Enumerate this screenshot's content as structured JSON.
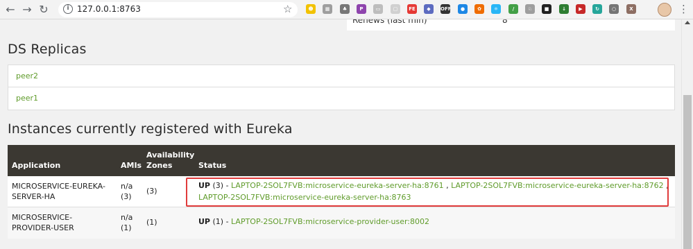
{
  "browser": {
    "url": "127.0.0.1:8763",
    "extensions": [
      {
        "icon": "smiley-ext-icon",
        "color": "#f2c200",
        "glyph": "☻"
      },
      {
        "icon": "grid-ext-icon",
        "color": "#9e9e9e",
        "glyph": "▦"
      },
      {
        "icon": "tree-ext-icon",
        "color": "#777777",
        "glyph": "♣"
      },
      {
        "icon": "purple-ext-icon",
        "color": "#8e44ad",
        "glyph": "P"
      },
      {
        "icon": "folder-ext-icon",
        "color": "#bdbdbd",
        "glyph": "▭"
      },
      {
        "icon": "doc-ext-icon",
        "color": "#d0d0d0",
        "glyph": "▢"
      },
      {
        "icon": "fe-ext-icon",
        "color": "#e53935",
        "glyph": "FE"
      },
      {
        "icon": "shield-ext-icon",
        "color": "#5c6bc0",
        "glyph": "◆"
      },
      {
        "icon": "off-ext-icon",
        "color": "#333333",
        "glyph": "OFF"
      },
      {
        "icon": "blue-circle-ext-icon",
        "color": "#1e88e5",
        "glyph": "●"
      },
      {
        "icon": "orange-ext-icon",
        "color": "#ef6c00",
        "glyph": "✿"
      },
      {
        "icon": "react-ext-icon",
        "color": "#29b6f6",
        "glyph": "⚛"
      },
      {
        "icon": "slash-ext-icon",
        "color": "#43a047",
        "glyph": "/"
      },
      {
        "icon": "cat-ext-icon",
        "color": "#9e9e9e",
        "glyph": "♘"
      },
      {
        "icon": "dark-ext-icon",
        "color": "#212121",
        "glyph": "■"
      },
      {
        "icon": "download-ext-icon",
        "color": "#2e7d32",
        "glyph": "↓"
      },
      {
        "icon": "play-ext-icon",
        "color": "#c62828",
        "glyph": "▶"
      },
      {
        "icon": "refresh-ext-icon",
        "color": "#26a69a",
        "glyph": "↻"
      },
      {
        "icon": "record-ext-icon",
        "color": "#757575",
        "glyph": "○"
      },
      {
        "icon": "x-ext-icon",
        "color": "#8d6e63",
        "glyph": "X"
      }
    ]
  },
  "stats": {
    "label": "Renews (last min)",
    "value": "8"
  },
  "replicas": {
    "title": "DS Replicas",
    "items": [
      "peer2",
      "peer1"
    ]
  },
  "instances": {
    "title": "Instances currently registered with Eureka",
    "headers": {
      "application": "Application",
      "amis": "AMIs",
      "zones_line1": "Availability",
      "zones_line2": "Zones",
      "status": "Status"
    },
    "rows": [
      {
        "app_line1": "MICROSERVICE-EUREKA-",
        "app_line2": "SERVER-HA",
        "amis_line1": "n/a",
        "amis_line2": "(3)",
        "zones": "(3)",
        "status_state": "UP",
        "status_count": " (3) - ",
        "links": [
          "LAPTOP-2SOL7FVB:microservice-eureka-server-ha:8761",
          "LAPTOP-2SOL7FVB:microservice-eureka-server-ha:8762",
          "LAPTOP-2SOL7FVB:microservice-eureka-server-ha:8763"
        ],
        "sep": " , "
      },
      {
        "app_line1": "MICROSERVICE-",
        "app_line2": "PROVIDER-USER",
        "amis_line1": "n/a",
        "amis_line2": "(1)",
        "zones": "(1)",
        "status_state": "UP",
        "status_count": " (1) - ",
        "links": [
          "LAPTOP-2SOL7FVB:microservice-provider-user:8002"
        ]
      }
    ]
  }
}
